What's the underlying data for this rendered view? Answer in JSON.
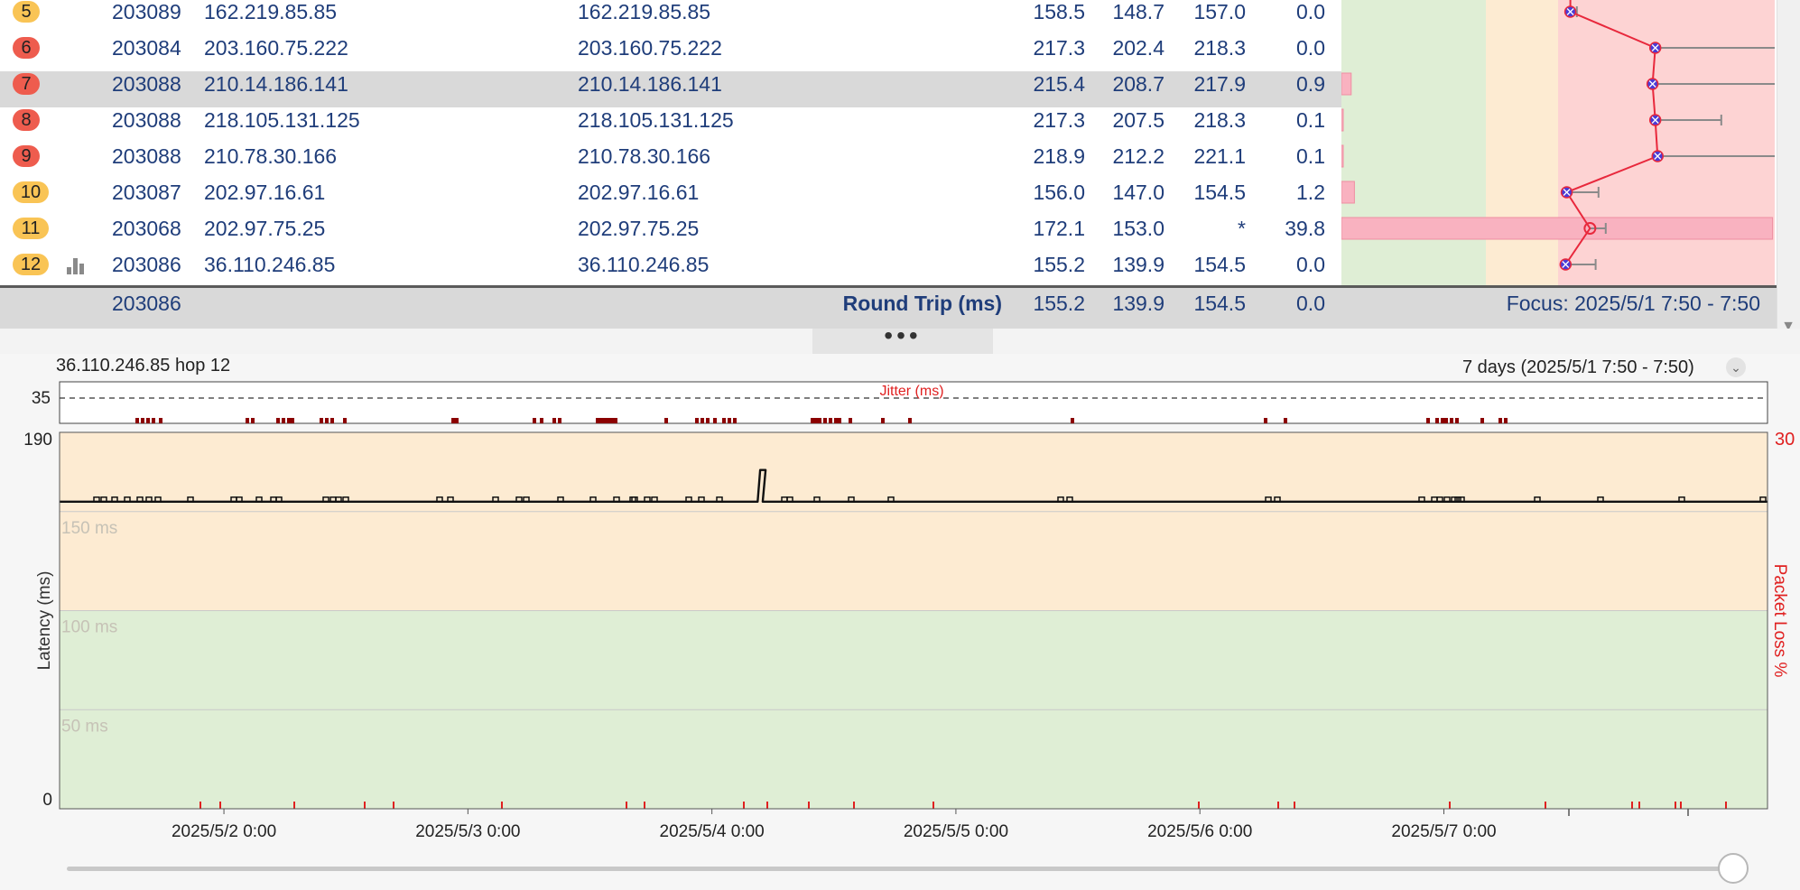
{
  "hops": [
    {
      "hop": "5",
      "badge": "y",
      "asn": "203089",
      "ip": "162.219.85.85",
      "name": "162.219.85.85",
      "avg": "158.5",
      "min": "148.7",
      "cur": "157.0",
      "pl": "0.0",
      "selected": false,
      "icon": false
    },
    {
      "hop": "6",
      "badge": "r",
      "asn": "203084",
      "ip": "203.160.75.222",
      "name": "203.160.75.222",
      "avg": "217.3",
      "min": "202.4",
      "cur": "218.3",
      "pl": "0.0",
      "selected": false,
      "icon": false
    },
    {
      "hop": "7",
      "badge": "r",
      "asn": "203088",
      "ip": "210.14.186.141",
      "name": "210.14.186.141",
      "avg": "215.4",
      "min": "208.7",
      "cur": "217.9",
      "pl": "0.9",
      "selected": true,
      "icon": false
    },
    {
      "hop": "8",
      "badge": "r",
      "asn": "203088",
      "ip": "218.105.131.125",
      "name": "218.105.131.125",
      "avg": "217.3",
      "min": "207.5",
      "cur": "218.3",
      "pl": "0.1",
      "selected": false,
      "icon": false
    },
    {
      "hop": "9",
      "badge": "r",
      "asn": "203088",
      "ip": "210.78.30.166",
      "name": "210.78.30.166",
      "avg": "218.9",
      "min": "212.2",
      "cur": "221.1",
      "pl": "0.1",
      "selected": false,
      "icon": false
    },
    {
      "hop": "10",
      "badge": "y",
      "asn": "203087",
      "ip": "202.97.16.61",
      "name": "202.97.16.61",
      "avg": "156.0",
      "min": "147.0",
      "cur": "154.5",
      "pl": "1.2",
      "selected": false,
      "icon": false
    },
    {
      "hop": "11",
      "badge": "y",
      "asn": "203068",
      "ip": "202.97.75.25",
      "name": "202.97.75.25",
      "avg": "172.1",
      "min": "153.0",
      "cur": "*",
      "pl": "39.8",
      "selected": false,
      "icon": false
    },
    {
      "hop": "12",
      "badge": "y",
      "asn": "203086",
      "ip": "36.110.246.85",
      "name": "36.110.246.85",
      "avg": "155.2",
      "min": "139.9",
      "cur": "154.5",
      "pl": "0.0",
      "selected": false,
      "icon": true
    }
  ],
  "summary": {
    "asn": "203086",
    "label": "Round Trip (ms)",
    "avg": "155.2",
    "min": "139.9",
    "cur": "154.5",
    "pl": "0.0",
    "focus": "Focus: 2025/5/1 7:50 - 7:50"
  },
  "hop_graph": {
    "scale_max_ms": 300,
    "hops": [
      {
        "avg": 158.5,
        "max": 163.0,
        "pl": 0.0,
        "pl_bar": false
      },
      {
        "avg": 217.3,
        "max": 455.0,
        "pl": 0.0,
        "pl_bar": false
      },
      {
        "avg": 215.4,
        "max": 440.0,
        "pl": 0.9,
        "pl_bar": true
      },
      {
        "avg": 217.3,
        "max": 263.0,
        "pl": 0.1,
        "pl_bar": true
      },
      {
        "avg": 218.9,
        "max": 409.0,
        "pl": 0.1,
        "pl_bar": true
      },
      {
        "avg": 156.0,
        "max": 178.0,
        "pl": 1.2,
        "pl_bar": true
      },
      {
        "avg": 172.1,
        "max": 183.0,
        "pl": 39.8,
        "pl_bar": true,
        "lost": true
      },
      {
        "avg": 155.2,
        "max": 176.0,
        "pl": 0.0,
        "pl_bar": false
      }
    ]
  },
  "chart": {
    "target_label": "36.110.246.85 hop 12",
    "range_label": "7 days (2025/5/1 7:50 - 7:50)",
    "jitter_label": "Jitter (ms)",
    "jitter_tick": "35",
    "latency_axis_label": "Latency (ms)",
    "loss_axis_label": "Packet Loss %",
    "loss_max": "30",
    "y_top": "190",
    "y_zero": "0",
    "gridlines": [
      "150 ms",
      "100 ms",
      "50 ms"
    ],
    "x_labels": [
      "2025/5/2 0:00",
      "2025/5/3 0:00",
      "2025/5/4 0:00",
      "2025/5/5 0:00",
      "2025/5/6 0:00",
      "2025/5/7 0:00"
    ]
  },
  "chart_data": {
    "type": "line",
    "title": "",
    "xlabel": "",
    "ylabel": "Latency (ms)",
    "ylim": [
      0,
      190
    ],
    "y2label": "Packet Loss %",
    "y2lim": [
      0,
      30
    ],
    "x_range": [
      "2025/5/1 7:50",
      "2025/5/8 7:50"
    ],
    "grid": true,
    "series": [
      {
        "x": [
          "2025/5/1 7:50",
          "2025/5/1 12:00",
          "2025/5/2 0:00",
          "2025/5/2 12:00",
          "2025/5/3 0:00",
          "2025/5/3 12:00",
          "2025/5/4 0:00",
          "2025/5/4 4:30",
          "2025/5/4 4:45",
          "2025/5/4 5:00",
          "2025/5/4 12:00",
          "2025/5/5 0:00",
          "2025/5/5 12:00",
          "2025/5/6 0:00",
          "2025/5/6 12:00",
          "2025/5/7 0:00",
          "2025/5/7 12:00",
          "2025/5/8 7:50"
        ],
        "values": [
          155,
          155,
          155,
          155,
          155,
          155,
          155,
          155,
          171,
          155,
          155,
          155,
          155,
          155,
          155,
          155,
          155,
          155
        ]
      }
    ],
    "bands": [
      {
        "from": 0,
        "to": 100,
        "color": "#dfeed5"
      },
      {
        "from": 100,
        "to": 190,
        "color": "#fdebd2"
      }
    ]
  },
  "colors": {
    "table_text": "#1f3d7a",
    "badge_yellow": "#f9c455",
    "badge_red": "#ee5c4e",
    "zone_green": "#dfeed5",
    "zone_orange": "#fdebd2",
    "zone_red": "#fdd3d3",
    "loss_red": "#e02020",
    "jitter_dark": "#8b0000"
  }
}
